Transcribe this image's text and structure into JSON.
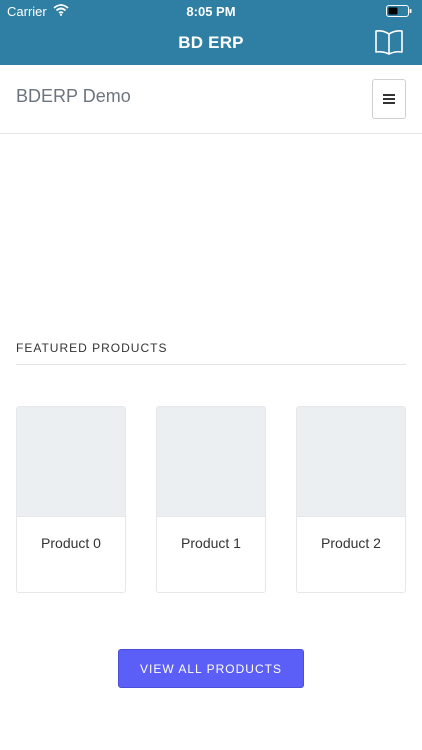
{
  "status_bar": {
    "carrier": "Carrier",
    "time": "8:05 PM"
  },
  "nav_bar": {
    "title": "BD ERP",
    "icon": "book-icon"
  },
  "header": {
    "brand": "BDERP Demo",
    "menu_icon": "hamburger-icon"
  },
  "featured": {
    "title": "FEATURED PRODUCTS",
    "products": [
      {
        "label": "Product 0"
      },
      {
        "label": "Product 1"
      },
      {
        "label": "Product 2"
      }
    ],
    "cta_label": "VIEW ALL PRODUCTS"
  },
  "colors": {
    "nav_bg": "#2e7fa3",
    "cta_bg": "#5b5ff7"
  }
}
